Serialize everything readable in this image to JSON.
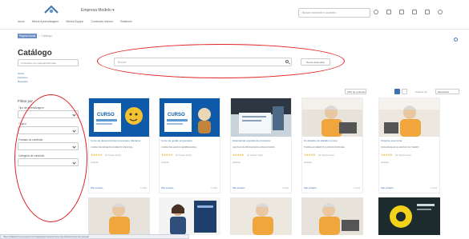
{
  "header": {
    "company": "Empresa Modelo ▾",
    "nav": [
      "Início",
      "Minha Aprendizagem",
      "Minha Equipe",
      "Conteúdo Interno",
      "Relatório"
    ],
    "search_placeholder": "Buscar conteúdo e usuários"
  },
  "breadcrumb": {
    "current": "Página Inicial",
    "next": "Catálogo"
  },
  "page": {
    "title": "Catálogo",
    "filter_placeholder": "Conteúdos por categoria/formato",
    "links": [
      "Todos",
      "Favoritos",
      "Recentes"
    ]
  },
  "search": {
    "placeholder": "Buscar",
    "advanced_label": "Busca avançada"
  },
  "sidebar": {
    "heading": "Filtrar por",
    "fields": [
      {
        "label": "Tipo de aprendizagem",
        "value": ""
      },
      {
        "label": "Tópico",
        "value": ""
      },
      {
        "label": "Formato do conteúdo",
        "value": ""
      },
      {
        "label": "Categoria de conteúdo",
        "value": ""
      }
    ]
  },
  "controls": {
    "filter_button": "Filtro de conteúdo",
    "sort_label": "Ordenar por",
    "sort_value": "Relevância"
  },
  "cards": [
    {
      "title": "Curso de desenvolvimento pessoal e liderança",
      "subtitle": "CURSO DE DESENVOLVIMENTO PESSOAL",
      "stars": "★★★★★",
      "rating": "(1) Cursos Livres",
      "price": "Gratuito",
      "status": "Não iniciado",
      "duration": "1 hora"
    },
    {
      "title": "Curso de gestão empresarial",
      "subtitle": "CURSO DE GESTÃO EMPRESARIAL",
      "stars": "★★★★★",
      "rating": "(1) Cursos Livres",
      "price": "Gratuito",
      "status": "Não iniciado",
      "duration": "1 hora"
    },
    {
      "title": "Entendendo a gestão de processos",
      "subtitle": "GESTÃO DE PROCESSOS E RESULTADOS",
      "stars": "★★★★★",
      "rating": "(1) Cursos Livres",
      "price": "Gratuito",
      "status": "Não iniciado",
      "duration": "1 hora"
    },
    {
      "title": "Os desafios do trabalho remoto",
      "subtitle": "TRABALHO REMOTO E PRODUTIVIDADE",
      "stars": "★★★★★",
      "rating": "(1) Cursos Livres",
      "price": "Gratuito",
      "status": "Não iniciado",
      "duration": "1 hora"
    },
    {
      "title": "Organize sua rotina",
      "subtitle": "ORGANIZAÇÃO E GESTÃO DO TEMPO",
      "stars": "★★★★★",
      "rating": "(1) Cursos Livres",
      "price": "Gratuito",
      "status": "Não iniciado",
      "duration": "1 hora"
    }
  ],
  "statusbar": "https://plataforma.exemplo.com/catalogo/conteudo/curso-de-desenvolvimento-pessoal"
}
